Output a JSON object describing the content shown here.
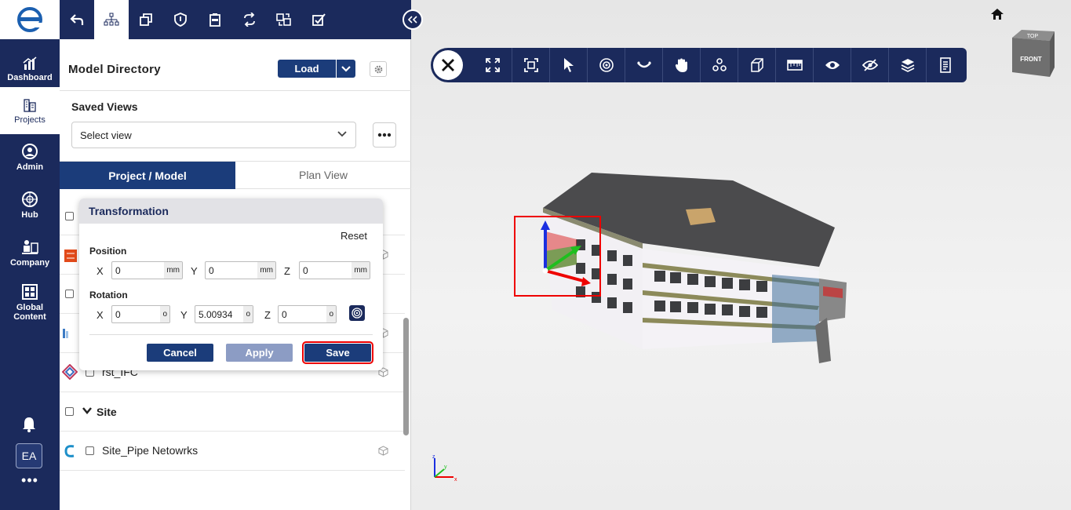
{
  "nav": {
    "items": [
      {
        "label": "Dashboard",
        "icon": "dashboard-chart-icon"
      },
      {
        "label": "Projects",
        "icon": "buildings-icon"
      },
      {
        "label": "Admin",
        "icon": "admin-user-icon"
      },
      {
        "label": "Hub",
        "icon": "hub-globe-icon"
      },
      {
        "label": "Company",
        "icon": "company-icon"
      },
      {
        "label": "Global Content",
        "icon": "global-content-icon"
      }
    ],
    "avatar": "EA",
    "more": "•••"
  },
  "panel": {
    "title": "Model Directory",
    "load_label": "Load",
    "saved_views_title": "Saved Views",
    "select_view_placeholder": "Select view",
    "tabs": [
      "Project / Model",
      "Plan View"
    ],
    "tree": {
      "rst_ifc": "rst_IFC",
      "site": "Site",
      "site_pipe": "Site_Pipe Netowrks"
    }
  },
  "transformation": {
    "title": "Transformation",
    "reset": "Reset",
    "position_label": "Position",
    "rotation_label": "Rotation",
    "position": {
      "x": "0",
      "y": "0",
      "z": "0",
      "unit": "mm"
    },
    "rotation": {
      "x": "0",
      "y": "5.00934",
      "z": "0",
      "unit": "o"
    },
    "axes": [
      "X",
      "Y",
      "Z"
    ],
    "cancel": "Cancel",
    "apply": "Apply",
    "save": "Save"
  },
  "viewcube": {
    "top": "TOP",
    "front": "FRONT"
  },
  "colors": {
    "navy": "#1b2a5c",
    "accent": "#1b3c7a",
    "highlight": "#e00000"
  }
}
